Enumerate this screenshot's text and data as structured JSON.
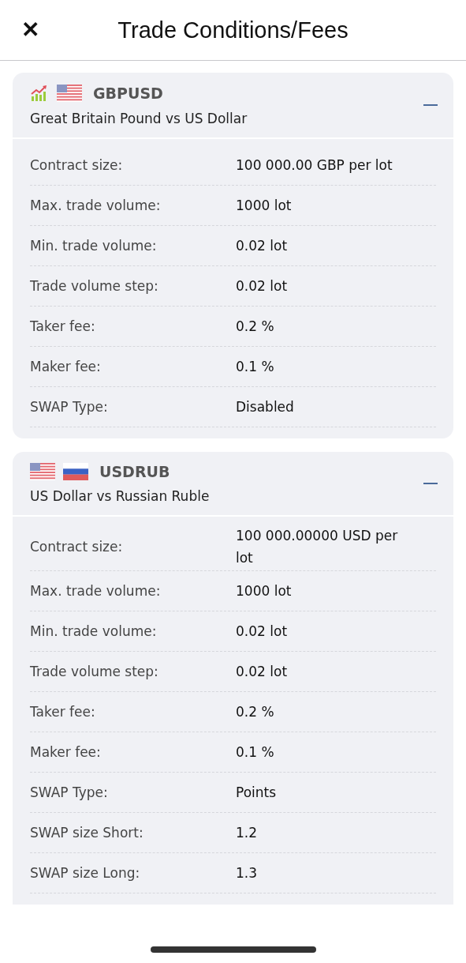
{
  "header": {
    "close_glyph": "✕",
    "title": "Trade Conditions/Fees"
  },
  "instruments": [
    {
      "icons": [
        {
          "kind": "chart"
        },
        {
          "kind": "us-flag"
        }
      ],
      "symbol": "GBPUSD",
      "name": "Great Britain Pound vs US Dollar",
      "expanded": true,
      "rows": [
        {
          "label": "Contract size:",
          "value": "100 000.00 GBP per lot"
        },
        {
          "label": "Max. trade volume:",
          "value": "1000 lot"
        },
        {
          "label": "Min. trade volume:",
          "value": "0.02 lot"
        },
        {
          "label": "Trade volume step:",
          "value": "0.02 lot"
        },
        {
          "label": "Taker fee:",
          "value": "0.2 %"
        },
        {
          "label": "Maker fee:",
          "value": "0.1 %"
        },
        {
          "label": "SWAP Type:",
          "value": "Disabled"
        }
      ]
    },
    {
      "icons": [
        {
          "kind": "us-flag"
        },
        {
          "kind": "ru-flag"
        }
      ],
      "symbol": "USDRUB",
      "name": "US Dollar vs Russian Ruble",
      "expanded": true,
      "rows": [
        {
          "label": "Contract size:",
          "value": "100 000.00000 USD per lot"
        },
        {
          "label": "Max. trade volume:",
          "value": "1000 lot"
        },
        {
          "label": "Min. trade volume:",
          "value": "0.02 lot"
        },
        {
          "label": "Trade volume step:",
          "value": "0.02 lot"
        },
        {
          "label": "Taker fee:",
          "value": "0.2 %"
        },
        {
          "label": "Maker fee:",
          "value": "0.1 %"
        },
        {
          "label": "SWAP Type:",
          "value": "Points"
        },
        {
          "label": "SWAP size Short:",
          "value": "1.2"
        },
        {
          "label": "SWAP size Long:",
          "value": "1.3"
        }
      ]
    }
  ]
}
